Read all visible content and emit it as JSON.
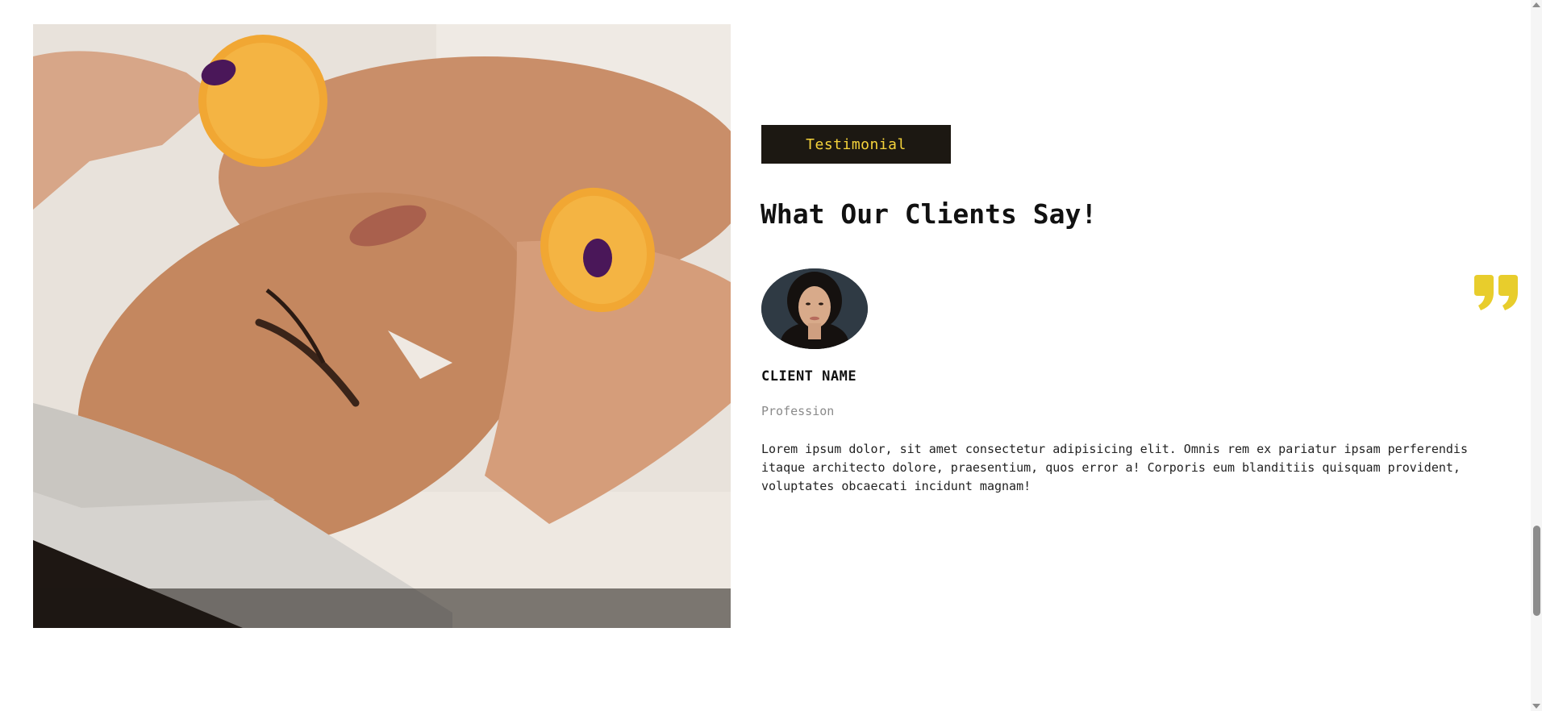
{
  "testimonial": {
    "badge_label": "Testimonial",
    "title": "What Our Clients Say!",
    "client_name": "CLIENT NAME",
    "profession": "Profession",
    "text": "Lorem ipsum dolor, sit amet consectetur adipisicing elit. Omnis rem ex pariatur ipsam perferendis itaque architecto dolore, praesentium, quos error a! Corporis eum blanditiis quisquam provident, voluptates obcaecati incidunt magnam!"
  },
  "colors": {
    "badge_bg": "#1c1812",
    "accent_yellow": "#f5d33b",
    "quote_yellow": "#e8cd2c"
  },
  "icons": {
    "quote": "quote-icon",
    "scroll_up": "scroll-up-arrow-icon",
    "scroll_down": "scroll-down-arrow-icon"
  }
}
